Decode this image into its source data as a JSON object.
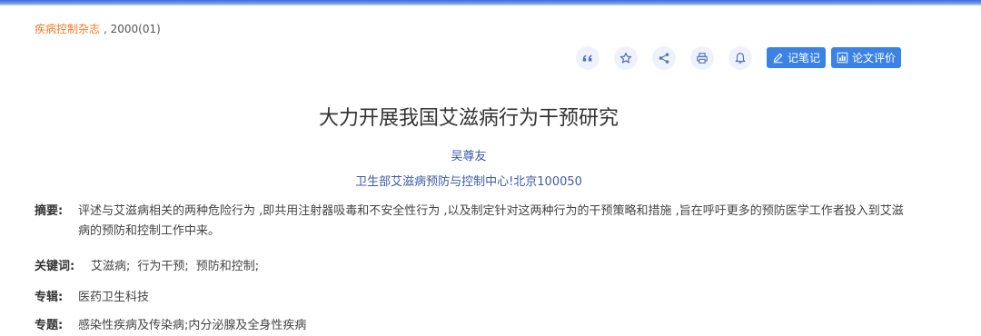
{
  "journal": {
    "name": "疾病控制杂志",
    "issue": ", 2000(01)"
  },
  "toolbar": {
    "icons": [
      "quote-icon",
      "star-icon",
      "share-icon",
      "print-icon",
      "bell-icon"
    ],
    "note_label": "记笔记",
    "review_label": "论文评价"
  },
  "article": {
    "title": "大力开展我国艾滋病行为干预研究",
    "author": "吴尊友",
    "affiliation": "卫生部艾滋病预防与控制中心!北京100050",
    "abstract_label": "摘要:",
    "abstract": "评述与艾滋病相关的两种危险行为 ,即共用注射器吸毒和不安全性行为 ,以及制定针对这两种行为的干预策略和措施 ,旨在呼吁更多的预防医学工作者投入到艾滋病的预防和控制工作中来。",
    "keywords_label": "关键词:",
    "keywords": [
      "艾滋病;",
      "行为干预;",
      "预防和控制;"
    ],
    "special_label": "专辑:",
    "special": "医药卫生科技",
    "topic_label": "专题:",
    "topic": "感染性疾病及传染病;内分泌腺及全身性疾病"
  },
  "colors": {
    "accent": "#3b82e6",
    "link": "#3b5ba7",
    "journal": "#f07a2a"
  }
}
